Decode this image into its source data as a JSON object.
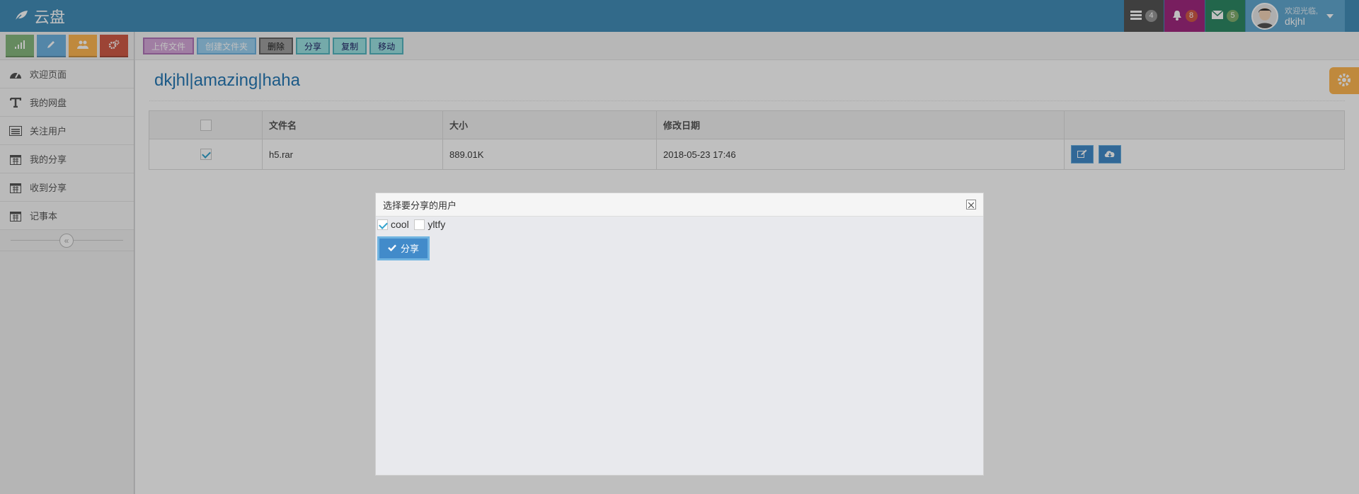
{
  "brand": {
    "title": "云盘"
  },
  "navbar": {
    "tasks_count": "4",
    "notifications_count": "8",
    "messages_count": "5",
    "welcome": "欢迎光临,",
    "username": "dkjhl"
  },
  "toolbar": {
    "upload": "上传文件",
    "create_folder": "创建文件夹",
    "delete": "删除",
    "share": "分享",
    "copy": "复制",
    "move": "移动"
  },
  "sidebar": {
    "items": [
      {
        "label": "欢迎页面",
        "icon": "dashboard-icon"
      },
      {
        "label": "我的网盘",
        "icon": "text-icon"
      },
      {
        "label": "关注用户",
        "icon": "list-icon"
      },
      {
        "label": "我的分享",
        "icon": "calendar-icon"
      },
      {
        "label": "收到分享",
        "icon": "calendar-icon"
      },
      {
        "label": "记事本",
        "icon": "calendar-icon"
      }
    ]
  },
  "page": {
    "title": "dkjhl|amazing|haha"
  },
  "table": {
    "headers": {
      "name": "文件名",
      "size": "大小",
      "date": "修改日期"
    },
    "rows": [
      {
        "name": "h5.rar",
        "size": "889.01K",
        "date": "2018-05-23 17:46",
        "checked": true
      }
    ]
  },
  "dialog": {
    "title": "选择要分享的用户",
    "users": [
      {
        "name": "cool",
        "checked": true
      },
      {
        "name": "yltfy",
        "checked": false
      }
    ],
    "share_button": "分享"
  },
  "colors": {
    "navbar": "#438eb9",
    "title": "#2679b5",
    "primary_button": "#428bca"
  }
}
